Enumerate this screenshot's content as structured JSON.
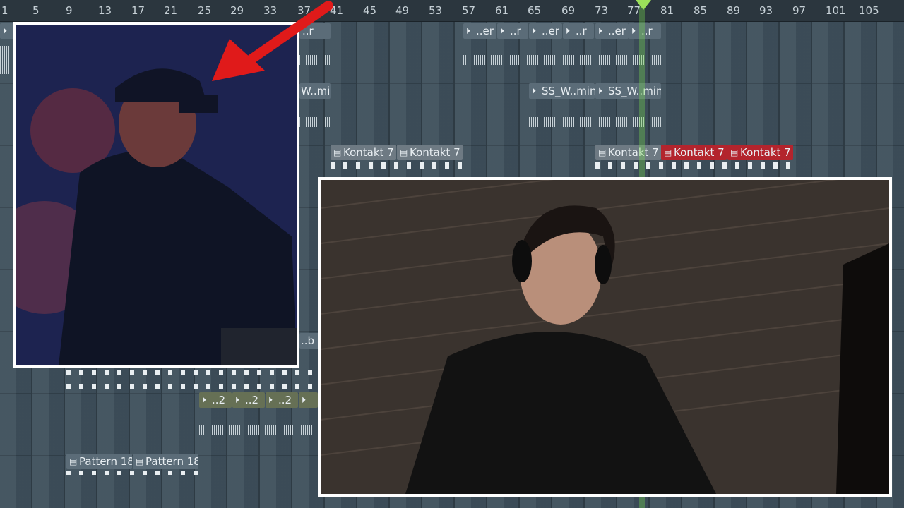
{
  "ruler": {
    "bars": [
      "1",
      "5",
      "9",
      "13",
      "17",
      "21",
      "25",
      "29",
      "33",
      "37",
      "41",
      "45",
      "49",
      "53",
      "57",
      "61",
      "65",
      "69",
      "73",
      "77",
      "81",
      "85",
      "89",
      "93",
      "97",
      "101",
      "105"
    ]
  },
  "clips": {
    "audio_top": [
      {
        "label": "..er"
      },
      {
        "label": "..r"
      },
      {
        "label": "..er"
      },
      {
        "label": "..r"
      },
      {
        "label": "..er"
      },
      {
        "label": ""
      },
      {
        "label": "..r"
      }
    ],
    "audio_left_partial": "..r",
    "ss": [
      {
        "label": "W..min"
      },
      {
        "label": "SS_W..min"
      },
      {
        "label": "SS_W..min"
      }
    ],
    "kontakt": [
      {
        "label": "Kontakt 7"
      },
      {
        "label": "Kontakt 7"
      },
      {
        "label": "Kontakt 7"
      },
      {
        "label": "Kontakt 7"
      },
      {
        "label": "Kontakt 7"
      }
    ],
    "olive": [
      {
        "label": "..2"
      },
      {
        "label": "..2"
      },
      {
        "label": "..2"
      }
    ],
    "misc_b": "..b",
    "patterns": [
      {
        "label": "Pattern 18"
      },
      {
        "label": "Pattern 18"
      }
    ]
  },
  "colors": {
    "kontakt_red": "#b3242d",
    "playhead": "#9be05a",
    "arrow": "#e01a1a"
  },
  "icons": {
    "audio_clip": "audio-clip-icon",
    "pattern_clip": "pattern-clip-icon",
    "playhead_marker": "playhead-marker-icon",
    "arrow": "red-arrow-icon"
  }
}
